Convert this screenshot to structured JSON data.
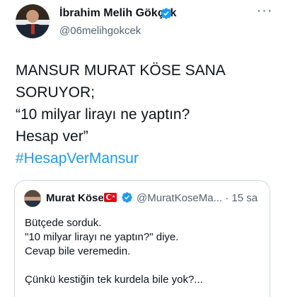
{
  "author": {
    "name": "İbrahim Melih Gökçek",
    "handle": "@06melihgokcek",
    "verified": true
  },
  "tweet": {
    "lines": [
      "MANSUR MURAT KÖSE SANA",
      "SORUYOR;",
      "“10 milyar lirayı ne yaptın?",
      "Hesap ver”"
    ],
    "hashtag": "#HesapVerMansur"
  },
  "quoted_tweet": {
    "name": "Murat Köse",
    "handle_time": "@MuratKoseMa... · 15 sa",
    "lines": [
      "Bütçede sorduk.",
      "\"10 milyar lirayı ne yaptın?\" diye.",
      "Cevap bile veremedin.",
      "",
      "Çünkü kestiğin tek kurdela bile yok?..."
    ]
  },
  "colors": {
    "link": "#1d9bf0",
    "verified": "#1d9bf0",
    "secondary_text": "#536471",
    "border": "#cfd9de"
  },
  "icons": {
    "more": "more-options-icon",
    "verified": "verified-badge-icon",
    "flag": "turkey-flag-icon"
  }
}
